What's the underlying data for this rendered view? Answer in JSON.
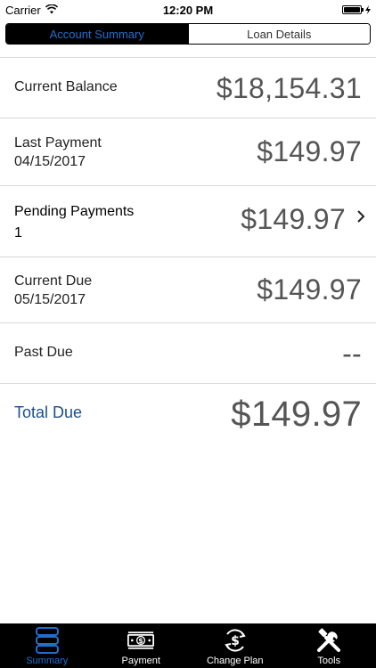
{
  "status_bar": {
    "carrier": "Carrier",
    "time": "12:20 PM",
    "battery_level": 1.0
  },
  "segmented": {
    "tabs": [
      {
        "label": "Account Summary",
        "active": true
      },
      {
        "label": "Loan Details",
        "active": false
      }
    ]
  },
  "summary": {
    "current_balance": {
      "label": "Current Balance",
      "amount": "$18,154.31"
    },
    "last_payment": {
      "label": "Last Payment",
      "date": "04/15/2017",
      "amount": "$149.97"
    },
    "pending_payments": {
      "label": "Pending Payments",
      "count": "1",
      "amount": "$149.97"
    },
    "current_due": {
      "label": "Current Due",
      "date": "05/15/2017",
      "amount": "$149.97"
    },
    "past_due": {
      "label": "Past Due",
      "amount": "--"
    },
    "total_due": {
      "label": "Total Due",
      "amount": "$149.97"
    }
  },
  "tab_bar": {
    "items": [
      {
        "label": "Summary",
        "icon": "server-stack-icon",
        "active": true
      },
      {
        "label": "Payment",
        "icon": "dollar-bill-icon",
        "active": false
      },
      {
        "label": "Change Plan",
        "icon": "dollar-cycle-icon",
        "active": false
      },
      {
        "label": "Tools",
        "icon": "tools-icon",
        "active": false
      }
    ]
  },
  "colors": {
    "accent": "#1f6fcf",
    "total_label": "#1a4f8f",
    "amount_text": "#555555",
    "divider": "#d8d8d8"
  }
}
